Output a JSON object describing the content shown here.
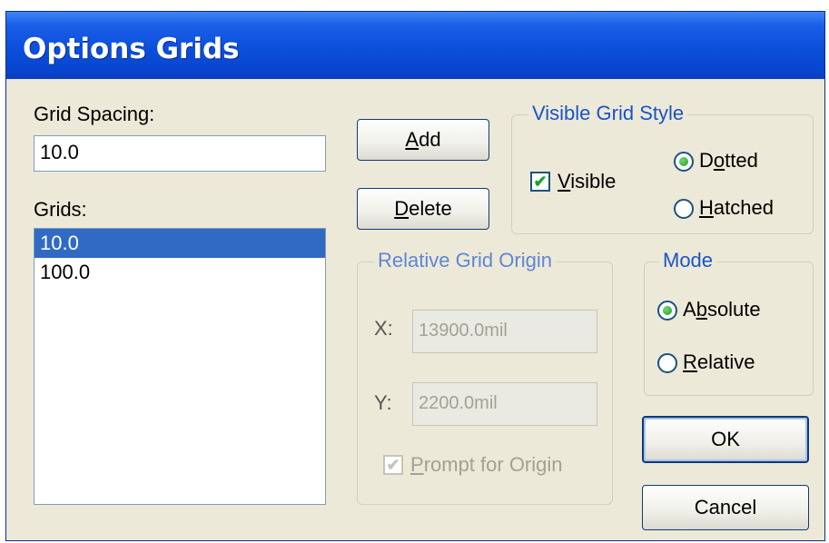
{
  "window": {
    "title": "Options Grids"
  },
  "grid_spacing": {
    "label": "Grid Spacing:",
    "value": "10.0"
  },
  "grids": {
    "label": "Grids:",
    "items": [
      "10.0",
      "100.0"
    ],
    "selected": "10.0"
  },
  "buttons": {
    "add": "Add",
    "delete": "Delete",
    "ok": "OK",
    "cancel": "Cancel"
  },
  "visible_grid_style": {
    "title": "Visible Grid Style",
    "visible_label": "Visible",
    "visible_checked": true,
    "dotted_label": "Dotted",
    "hatched_label": "Hatched",
    "selected": "Dotted"
  },
  "relative_grid_origin": {
    "title": "Relative Grid Origin",
    "x_label": "X:",
    "x_value": "13900.0mil",
    "y_label": "Y:",
    "y_value": "2200.0mil",
    "prompt_label": "Prompt for Origin",
    "prompt_checked": true,
    "enabled": false
  },
  "mode": {
    "title": "Mode",
    "absolute_label": "Absolute",
    "relative_label": "Relative",
    "selected": "Absolute"
  },
  "colors": {
    "titlebar": "#0b4fdb",
    "selection": "#316ac5",
    "group_title": "#1a54c6"
  }
}
